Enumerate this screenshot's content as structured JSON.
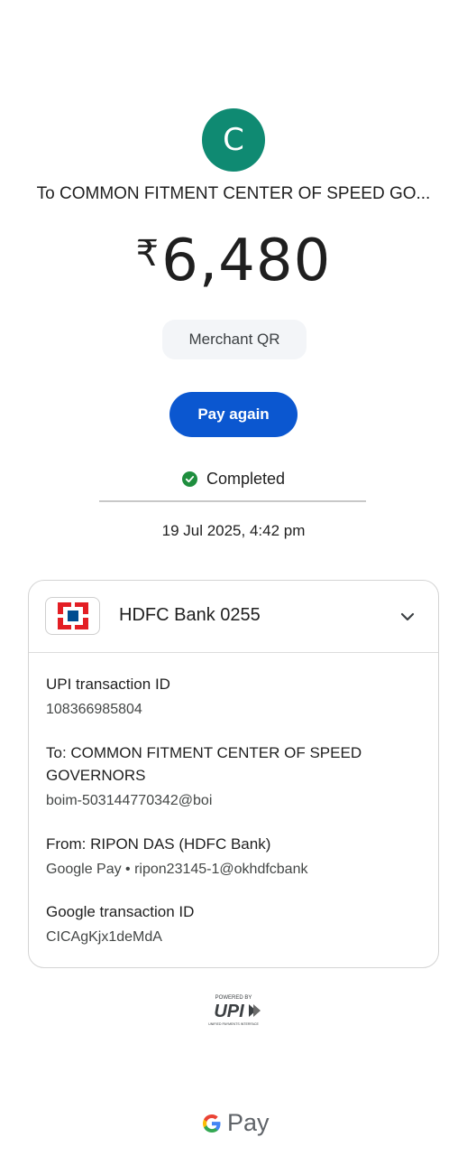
{
  "recipient": {
    "avatar_letter": "C",
    "title": "To COMMON FITMENT CENTER OF SPEED GO...",
    "avatar_color": "#0f8a72"
  },
  "amount": {
    "currency_symbol": "₹",
    "value": "6,480"
  },
  "chip_label": "Merchant QR",
  "pay_again_label": "Pay again",
  "status": {
    "text": "Completed",
    "color": "#1e8e3e"
  },
  "datetime": "19 Jul 2025, 4:42 pm",
  "card": {
    "bank_name": "HDFC Bank 0255",
    "details": [
      {
        "label": "UPI transaction ID",
        "value": "108366985804"
      },
      {
        "label": "To: COMMON FITMENT CENTER OF SPEED GOVERNORS",
        "value": "boim-503144770342@boi"
      },
      {
        "label": "From: RIPON DAS (HDFC Bank)",
        "value": "Google Pay • ripon23145-1@okhdfcbank"
      },
      {
        "label": "Google transaction ID",
        "value": "CICAgKjx1deMdA"
      }
    ]
  },
  "upi_logo": {
    "powered_by": "POWERED BY",
    "mark": "UPI",
    "tagline": "UNIFIED PAYMENTS INTERFACE"
  },
  "footer": {
    "g_letter": "G",
    "pay_text": "Pay"
  },
  "colors": {
    "primary_button": "#0b57d0",
    "chip_bg": "#f3f5f8",
    "hdfc_red": "#e31e24",
    "hdfc_blue": "#004c8f"
  }
}
